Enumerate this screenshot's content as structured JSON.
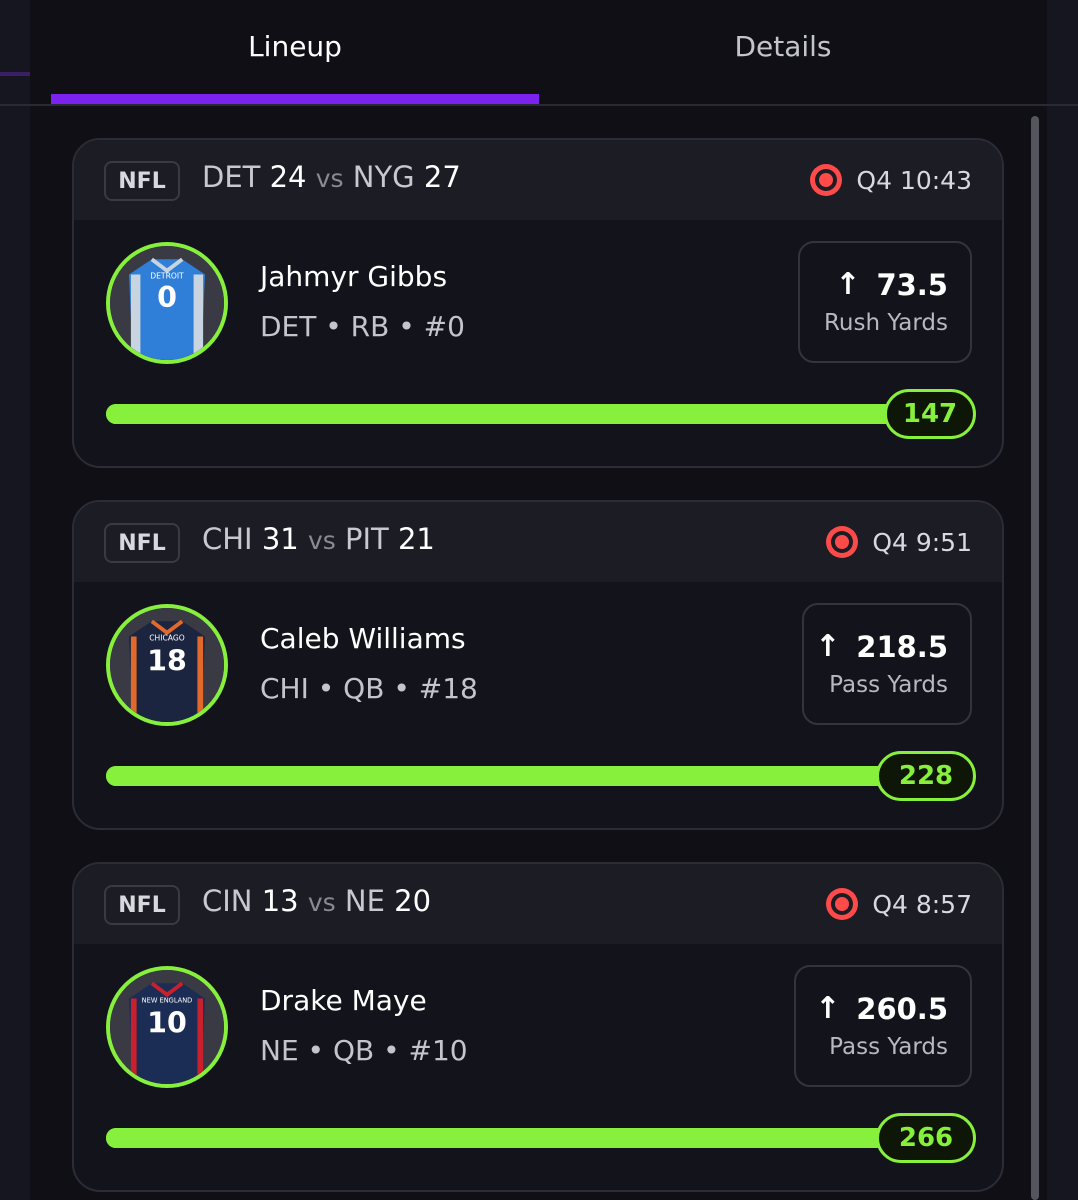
{
  "tabs": [
    {
      "label": "Lineup",
      "active": true
    },
    {
      "label": "Details",
      "active": false
    }
  ],
  "colors": {
    "accent": "#7b22ee",
    "progress": "#86f03c",
    "live": "#ff4a4a"
  },
  "cards": [
    {
      "league": "NFL",
      "team_a": "DET",
      "score_a": "24",
      "vs": "vs",
      "team_b": "NYG",
      "score_b": "27",
      "clock": "Q4 10:43",
      "player_name": "Jahmyr Gibbs",
      "player_meta": "DET • RB • #0",
      "jersey_text": "DETROIT",
      "jersey_number": "0",
      "stat_line": "73.5",
      "stat_label": "Rush Yards",
      "stat_direction": "up-arrow-icon",
      "current_value": "147",
      "progress": 1.0
    },
    {
      "league": "NFL",
      "team_a": "CHI",
      "score_a": "31",
      "vs": "vs",
      "team_b": "PIT",
      "score_b": "21",
      "clock": "Q4 9:51",
      "player_name": "Caleb Williams",
      "player_meta": "CHI • QB • #18",
      "jersey_text": "CHICAGO",
      "jersey_number": "18",
      "stat_line": "218.5",
      "stat_label": "Pass Yards",
      "stat_direction": "up-arrow-icon",
      "current_value": "228",
      "progress": 1.0
    },
    {
      "league": "NFL",
      "team_a": "CIN",
      "score_a": "13",
      "vs": "vs",
      "team_b": "NE",
      "score_b": "20",
      "clock": "Q4 8:57",
      "player_name": "Drake Maye",
      "player_meta": "NE • QB • #10",
      "jersey_text": "NEW ENGLAND",
      "jersey_number": "10",
      "stat_line": "260.5",
      "stat_label": "Pass Yards",
      "stat_direction": "up-arrow-icon",
      "current_value": "266",
      "progress": 1.0
    }
  ]
}
